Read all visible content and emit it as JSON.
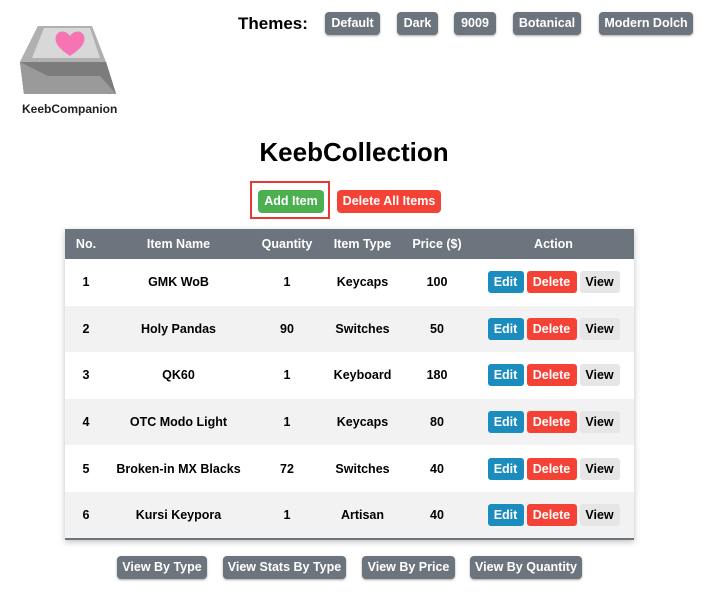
{
  "logo": {
    "text": "KeebCompanion",
    "icon": "keycap-heart-icon",
    "heart_color": "#f774b4"
  },
  "themes": {
    "label": "Themes:",
    "options": [
      "Default",
      "Dark",
      "9009",
      "Botanical",
      "Modern Dolch"
    ]
  },
  "title": "KeebCollection",
  "actions": {
    "add_label": "Add Item",
    "delete_all_label": "Delete All Items"
  },
  "table": {
    "headers": [
      "No.",
      "Item Name",
      "Quantity",
      "Item Type",
      "Price ($)",
      "Action"
    ],
    "rows": [
      {
        "no": "1",
        "name": "GMK WoB",
        "quantity": "1",
        "type": "Keycaps",
        "price": "100"
      },
      {
        "no": "2",
        "name": "Holy Pandas",
        "quantity": "90",
        "type": "Switches",
        "price": "50"
      },
      {
        "no": "3",
        "name": "QK60",
        "quantity": "1",
        "type": "Keyboard",
        "price": "180"
      },
      {
        "no": "4",
        "name": "OTC Modo Light",
        "quantity": "1",
        "type": "Keycaps",
        "price": "80"
      },
      {
        "no": "5",
        "name": "Broken-in MX Blacks",
        "quantity": "72",
        "type": "Switches",
        "price": "40"
      },
      {
        "no": "6",
        "name": "Kursi Keypora",
        "quantity": "1",
        "type": "Artisan",
        "price": "40"
      }
    ],
    "row_actions": {
      "edit": "Edit",
      "delete": "Delete",
      "view": "View"
    }
  },
  "bottom_buttons": [
    "View By Type",
    "View Stats By Type",
    "View By Price",
    "View By Quantity"
  ],
  "colors": {
    "header_bg": "#6c757d",
    "green": "#4caf50",
    "red": "#f44336",
    "blue": "#1a8dbe",
    "light": "#e6e6e6"
  }
}
